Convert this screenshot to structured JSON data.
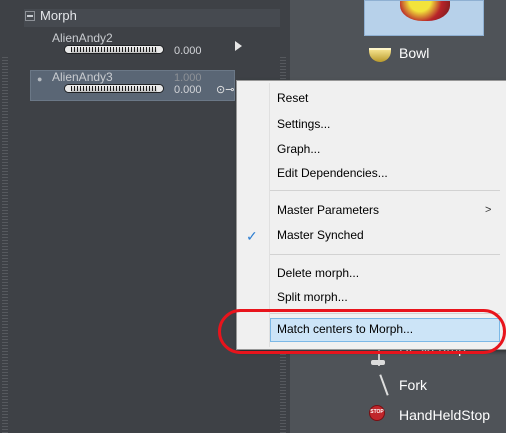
{
  "parameters": {
    "group_title": "Morph",
    "items": [
      {
        "name": "AlienAndy2",
        "value": "0.000"
      },
      {
        "name": "AlienAndy3",
        "secondary_value": "1.000",
        "value": "0.000"
      }
    ]
  },
  "library": {
    "items": [
      {
        "label": "Bowl",
        "icon": "bowl-icon"
      },
      {
        "label": "DeskLamp",
        "icon": "desk-lamp-icon"
      },
      {
        "label": "Fork",
        "icon": "fork-icon"
      },
      {
        "label": "HandHeldStop",
        "icon": "stop-sign-icon",
        "icon_text": "STOP"
      }
    ]
  },
  "context_menu": {
    "items": [
      "Reset",
      "Settings...",
      "Graph...",
      "Edit Dependencies...",
      "Master Parameters",
      "Master Synched",
      "Delete morph...",
      "Split morph...",
      "Match centers to Morph..."
    ],
    "submenu_arrow": ">",
    "checkmark": "✓",
    "highlight_color": "#cce4f7",
    "annotation_color": "#e8141c"
  }
}
